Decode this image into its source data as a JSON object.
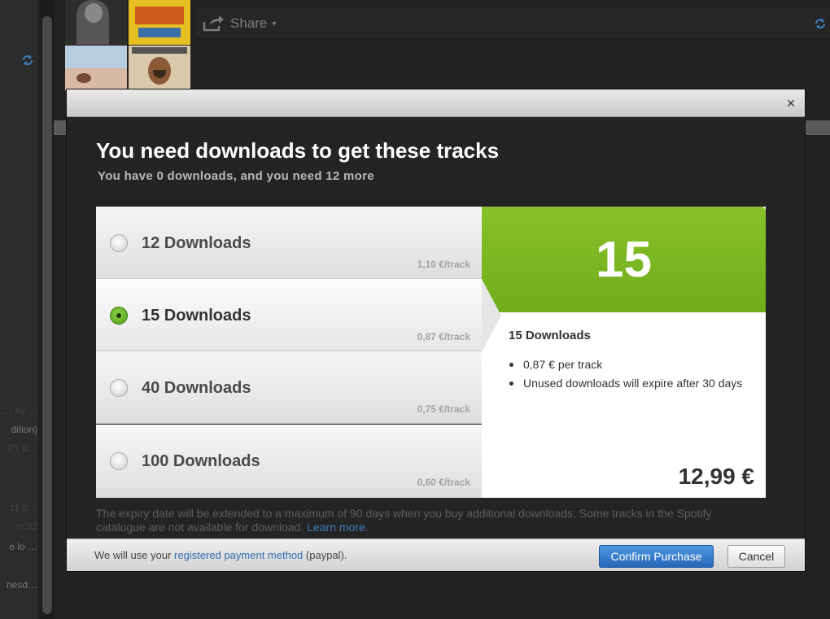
{
  "background": {
    "share_label": "Share",
    "share_arrow": "▾",
    "left_list": [
      {
        "text": "…, by …"
      },
      {
        "text": "dition)"
      },
      {
        "text": "0's b…"
      },
      {
        "text": "11 b…"
      },
      {
        "text": "cc32"
      },
      {
        "text": "e lo …"
      },
      {
        "text": "nesd…"
      }
    ],
    "icons": {
      "share": "share-icon",
      "sync": "sync-icon"
    }
  },
  "modal": {
    "close_label": "×",
    "title": "You need downloads to get these tracks",
    "subtitle": "You have 0 downloads, and you need 12 more",
    "options": [
      {
        "label": "12 Downloads",
        "price": "1,10 €/track",
        "selected": false
      },
      {
        "label": "15 Downloads",
        "price": "0,87 €/track",
        "selected": true
      },
      {
        "label": "40 Downloads",
        "price": "0,75 €/track",
        "selected": false
      },
      {
        "label": "100 Downloads",
        "price": "0,60 €/track",
        "selected": false
      }
    ],
    "detail": {
      "count": "15",
      "heading": "15 Downloads",
      "bullets": [
        "0,87 € per track",
        "Unused downloads will expire after 30 days"
      ],
      "total": "12,99 €"
    },
    "disclaimer": "The expiry date will be extended to a maximum of 90 days when you buy additional downloads. Some tracks in the Spotify catalogue are not available for download.",
    "learn_more": "Learn more",
    "learn_more_suffix": ".",
    "footer": {
      "prefix": "We will use your",
      "link": "registered payment method",
      "suffix": "(paypal).",
      "confirm_label": "Confirm Purchase",
      "cancel_label": "Cancel"
    }
  },
  "colors": {
    "accent_green": "#7ab823",
    "button_blue": "#2f74c4",
    "link_blue": "#3c7dbb"
  }
}
